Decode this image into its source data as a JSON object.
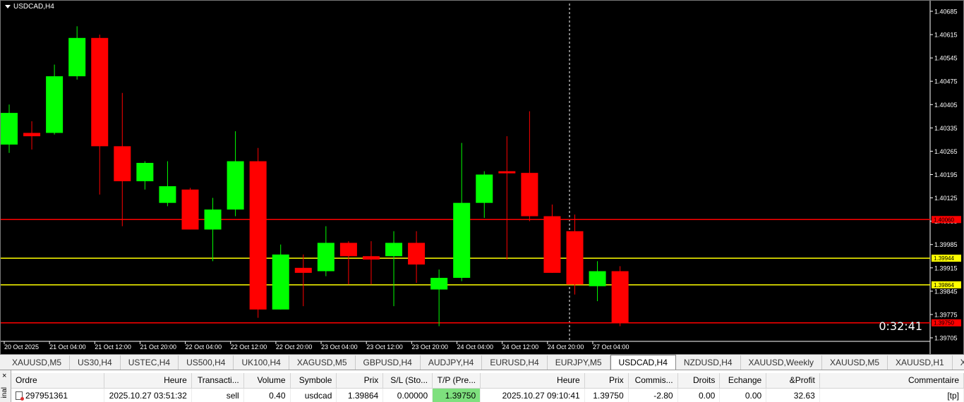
{
  "chart": {
    "title": "USDCAD,H4",
    "timer": "0:32:41",
    "price_min": 1.39705,
    "price_max": 1.40685,
    "price_ticks": [
      "1.40685",
      "1.40615",
      "1.40545",
      "1.40475",
      "1.40405",
      "1.40335",
      "1.40265",
      "1.40195",
      "1.40125",
      "1.40055",
      "1.39985",
      "1.39915",
      "1.39845",
      "1.39775",
      "1.39705"
    ],
    "time_labels": [
      "20 Oct 2025",
      "21 Oct 04:00",
      "21 Oct 12:00",
      "21 Oct 20:00",
      "22 Oct 04:00",
      "22 Oct 12:00",
      "22 Oct 20:00",
      "23 Oct 04:00",
      "23 Oct 12:00",
      "23 Oct 20:00",
      "24 Oct 04:00",
      "24 Oct 12:00",
      "24 Oct 20:00",
      "27 Oct 04:00"
    ],
    "bull_color": "#00ff00",
    "bear_color": "#ff0000",
    "lines": [
      {
        "price": 1.4006,
        "color": "#ff0000",
        "label": "1.40060"
      },
      {
        "price": 1.39944,
        "color": "#ffff00",
        "label": "1.39944"
      },
      {
        "price": 1.39864,
        "color": "#ffff00",
        "label": "1.39864"
      },
      {
        "price": 1.3975,
        "color": "#ff0000",
        "label": "1.39750"
      }
    ],
    "candles": [
      {
        "o": 1.40285,
        "h": 1.40405,
        "l": 1.4026,
        "c": 1.4038
      },
      {
        "o": 1.4032,
        "h": 1.40355,
        "l": 1.4027,
        "c": 1.4031
      },
      {
        "o": 1.4032,
        "h": 1.40525,
        "l": 1.40315,
        "c": 1.4049
      },
      {
        "o": 1.4049,
        "h": 1.4064,
        "l": 1.4048,
        "c": 1.40605
      },
      {
        "o": 1.40605,
        "h": 1.40615,
        "l": 1.40135,
        "c": 1.4028
      },
      {
        "o": 1.4028,
        "h": 1.4044,
        "l": 1.4004,
        "c": 1.40175
      },
      {
        "o": 1.40175,
        "h": 1.40235,
        "l": 1.4015,
        "c": 1.4023
      },
      {
        "o": 1.4011,
        "h": 1.40235,
        "l": 1.401,
        "c": 1.4016
      },
      {
        "o": 1.4015,
        "h": 1.40155,
        "l": 1.4003,
        "c": 1.4003
      },
      {
        "o": 1.4003,
        "h": 1.40125,
        "l": 1.39935,
        "c": 1.4009
      },
      {
        "o": 1.4009,
        "h": 1.40325,
        "l": 1.4007,
        "c": 1.40235
      },
      {
        "o": 1.40235,
        "h": 1.40275,
        "l": 1.39765,
        "c": 1.3979
      },
      {
        "o": 1.3979,
        "h": 1.39985,
        "l": 1.3979,
        "c": 1.39955
      },
      {
        "o": 1.39915,
        "h": 1.39955,
        "l": 1.398,
        "c": 1.399
      },
      {
        "o": 1.39905,
        "h": 1.4004,
        "l": 1.3989,
        "c": 1.3999
      },
      {
        "o": 1.3999,
        "h": 1.39995,
        "l": 1.39865,
        "c": 1.3995
      },
      {
        "o": 1.3995,
        "h": 1.39995,
        "l": 1.39865,
        "c": 1.3994
      },
      {
        "o": 1.3995,
        "h": 1.40025,
        "l": 1.398,
        "c": 1.3999
      },
      {
        "o": 1.3999,
        "h": 1.40025,
        "l": 1.3987,
        "c": 1.39925
      },
      {
        "o": 1.3985,
        "h": 1.3991,
        "l": 1.3974,
        "c": 1.39885
      },
      {
        "o": 1.39885,
        "h": 1.4029,
        "l": 1.39875,
        "c": 1.4011
      },
      {
        "o": 1.4011,
        "h": 1.40205,
        "l": 1.40065,
        "c": 1.40195
      },
      {
        "o": 1.40205,
        "h": 1.4031,
        "l": 1.3994,
        "c": 1.402
      },
      {
        "o": 1.402,
        "h": 1.40385,
        "l": 1.40055,
        "c": 1.4007
      },
      {
        "o": 1.4007,
        "h": 1.40105,
        "l": 1.399,
        "c": 1.399
      },
      {
        "o": 1.40025,
        "h": 1.40075,
        "l": 1.39835,
        "c": 1.39865
      },
      {
        "o": 1.3986,
        "h": 1.39935,
        "l": 1.39815,
        "c": 1.39905
      },
      {
        "o": 1.39905,
        "h": 1.3992,
        "l": 1.3974,
        "c": 1.3975
      }
    ]
  },
  "tabs": [
    {
      "label": "XAUUSD,M5",
      "active": false
    },
    {
      "label": "US30,H4",
      "active": false
    },
    {
      "label": "USTEC,H4",
      "active": false
    },
    {
      "label": "US500,H4",
      "active": false
    },
    {
      "label": "UK100,H4",
      "active": false
    },
    {
      "label": "XAGUSD,M5",
      "active": false
    },
    {
      "label": "GBPUSD,H4",
      "active": false
    },
    {
      "label": "AUDJPY,H4",
      "active": false
    },
    {
      "label": "EURUSD,H4",
      "active": false
    },
    {
      "label": "EURJPY,M5",
      "active": false
    },
    {
      "label": "USDCAD,H4",
      "active": true
    },
    {
      "label": "NZDUSD,H4",
      "active": false
    },
    {
      "label": "XAUUSD,Weekly",
      "active": false
    },
    {
      "label": "XAUUSD,M5",
      "active": false
    },
    {
      "label": "XAUUSD,H1",
      "active": false
    },
    {
      "label": "XAUUSD,H",
      "active": false
    }
  ],
  "terminal": {
    "close": "×",
    "side_label": "inal",
    "headers": [
      "Ordre",
      "Heure",
      "Transacti...",
      "Volume",
      "Symbole",
      "Prix",
      "S/L (Sto...",
      "T/P (Pre...",
      "Heure",
      "Prix",
      "Commis...",
      "Droits",
      "Echange",
      "&Profit",
      "Commentaire"
    ],
    "row": [
      "297951361",
      "2025.10.27 03:51:32",
      "sell",
      "0.40",
      "usdcad",
      "1.39864",
      "0.00000",
      "1.39750",
      "2025.10.27 09:10:41",
      "1.39750",
      "-2.80",
      "0.00",
      "0.00",
      "32.63",
      "[tp]"
    ]
  }
}
